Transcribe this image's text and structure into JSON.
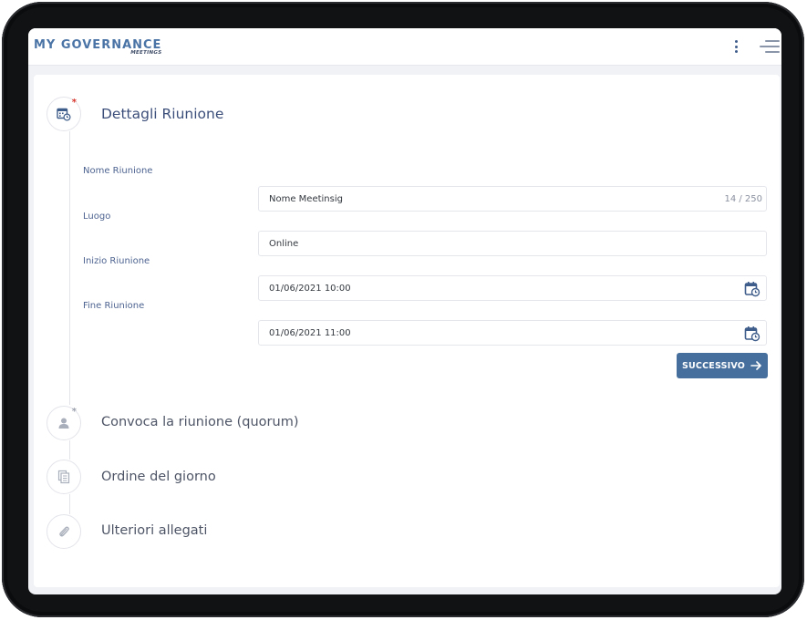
{
  "header": {
    "logo_main": "MY GOVERNANCE",
    "logo_sub": "MEETINGS",
    "icons": {
      "more": "kebab-vertical-icon",
      "menu": "hamburger-menu-icon"
    }
  },
  "steps": [
    {
      "title": "Dettagli Riunione",
      "icon": "calendar-clock-icon",
      "required": true,
      "active": true
    },
    {
      "title": "Convoca la riunione (quorum)",
      "icon": "user-icon",
      "required": true,
      "active": false
    },
    {
      "title": "Ordine del giorno",
      "icon": "document-list-icon",
      "required": false,
      "active": false
    },
    {
      "title": "Ulteriori allegati",
      "icon": "paperclip-icon",
      "required": false,
      "active": false
    }
  ],
  "form": {
    "name": {
      "label": "Nome Riunione",
      "value": "Nome Meetinsig",
      "counter": "14 / 250"
    },
    "location": {
      "label": "Luogo",
      "value": "Online"
    },
    "start": {
      "label": "Inizio Riunione",
      "value": "01/06/2021 10:00"
    },
    "end": {
      "label": "Fine Riunione",
      "value": "01/06/2021 11:00"
    }
  },
  "next_button": {
    "label": "SUCCESSIVO",
    "icon": "arrow-right-icon"
  },
  "colors": {
    "brand": "#4b74a6",
    "button": "#466f9d",
    "required_marker": "#d9342b",
    "background": "#f1f2f6"
  }
}
